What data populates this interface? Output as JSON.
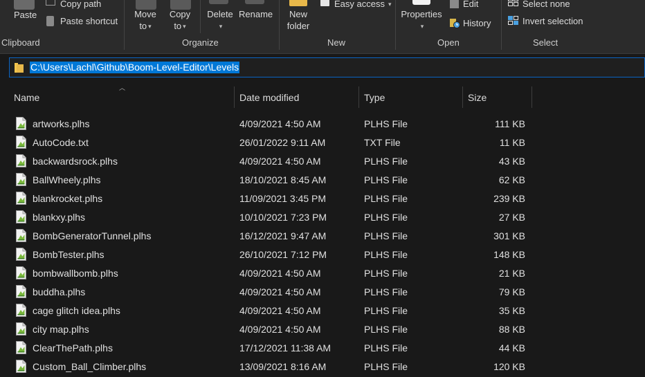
{
  "ribbon": {
    "clipboard": {
      "paste_label": "Paste",
      "copy_path_label": "Copy path",
      "paste_shortcut_label": "Paste shortcut",
      "group_label": "Clipboard"
    },
    "organize": {
      "move_to_label_1": "Move",
      "move_to_label_2": "to",
      "copy_to_label_1": "Copy",
      "copy_to_label_2": "to",
      "delete_label": "Delete",
      "rename_label": "Rename",
      "group_label": "Organize"
    },
    "new": {
      "new_folder_label_1": "New",
      "new_folder_label_2": "folder",
      "easy_access_label": "Easy access",
      "group_label": "New"
    },
    "open": {
      "properties_label": "Properties",
      "edit_label": "Edit",
      "history_label": "History",
      "group_label": "Open"
    },
    "select": {
      "select_none_label": "Select none",
      "invert_selection_label": "Invert selection",
      "group_label": "Select"
    }
  },
  "address_bar": {
    "path": "C:\\Users\\Lachl\\Github\\Boom-Level-Editor\\Levels"
  },
  "columns": {
    "name": "Name",
    "date_modified": "Date modified",
    "type": "Type",
    "size": "Size"
  },
  "files": [
    {
      "name": "artworks.plhs",
      "date": "4/09/2021 4:50 AM",
      "type": "PLHS File",
      "size": "111 KB"
    },
    {
      "name": "AutoCode.txt",
      "date": "26/01/2022 9:11 AM",
      "type": "TXT File",
      "size": "11 KB"
    },
    {
      "name": "backwardsrock.plhs",
      "date": "4/09/2021 4:50 AM",
      "type": "PLHS File",
      "size": "43 KB"
    },
    {
      "name": "BallWheely.plhs",
      "date": "18/10/2021 8:45 AM",
      "type": "PLHS File",
      "size": "62 KB"
    },
    {
      "name": "blankrocket.plhs",
      "date": "11/09/2021 3:45 PM",
      "type": "PLHS File",
      "size": "239 KB"
    },
    {
      "name": "blankxy.plhs",
      "date": "10/10/2021 7:23 PM",
      "type": "PLHS File",
      "size": "27 KB"
    },
    {
      "name": "BombGeneratorTunnel.plhs",
      "date": "16/12/2021 9:47 AM",
      "type": "PLHS File",
      "size": "301 KB"
    },
    {
      "name": "BombTester.plhs",
      "date": "26/10/2021 7:12 PM",
      "type": "PLHS File",
      "size": "148 KB"
    },
    {
      "name": "bombwallbomb.plhs",
      "date": "4/09/2021 4:50 AM",
      "type": "PLHS File",
      "size": "21 KB"
    },
    {
      "name": "buddha.plhs",
      "date": "4/09/2021 4:50 AM",
      "type": "PLHS File",
      "size": "79 KB"
    },
    {
      "name": "cage glitch idea.plhs",
      "date": "4/09/2021 4:50 AM",
      "type": "PLHS File",
      "size": "35 KB"
    },
    {
      "name": "city map.plhs",
      "date": "4/09/2021 4:50 AM",
      "type": "PLHS File",
      "size": "88 KB"
    },
    {
      "name": "ClearThePath.plhs",
      "date": "17/12/2021 11:38 AM",
      "type": "PLHS File",
      "size": "44 KB"
    },
    {
      "name": "Custom_Ball_Climber.plhs",
      "date": "13/09/2021 8:16 AM",
      "type": "PLHS File",
      "size": "120 KB"
    }
  ],
  "colors": {
    "background": "#191919",
    "ribbon": "#2b2b2b",
    "selection": "#0078d7",
    "focus_border": "#0a64c4",
    "file_icon_accent": "#7ab83c"
  },
  "icons": {
    "paste": "paste-icon",
    "copy_path": "copy-path-icon",
    "paste_shortcut": "paste-shortcut-icon",
    "move_to": "move-to-icon",
    "copy_to": "copy-to-icon",
    "delete": "delete-icon",
    "new_folder": "new-folder-icon",
    "easy_access": "easy-access-icon",
    "properties": "properties-icon",
    "edit": "edit-icon",
    "history": "history-icon",
    "select_none": "select-none-icon",
    "invert_selection": "invert-selection-icon",
    "folder": "folder-icon",
    "file": "file-icon"
  }
}
